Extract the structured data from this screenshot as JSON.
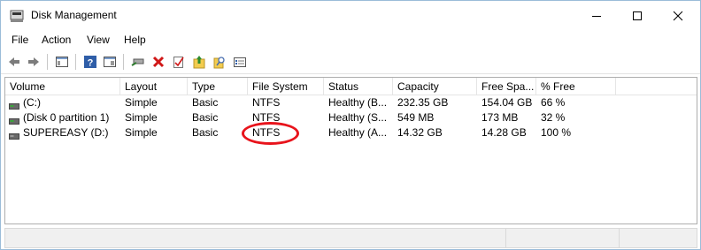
{
  "window": {
    "title": "Disk Management"
  },
  "menu": {
    "items": [
      "File",
      "Action",
      "View",
      "Help"
    ]
  },
  "toolbar": {
    "buttons": [
      "back-arrow-icon",
      "forward-arrow-icon",
      "console-tree-icon",
      "help-icon",
      "properties-icon",
      "connect-drive-icon",
      "delete-icon",
      "checklist-icon",
      "up-folder-icon",
      "search-folder-icon",
      "settings-panel-icon"
    ]
  },
  "table": {
    "columns": [
      "Volume",
      "Layout",
      "Type",
      "File System",
      "Status",
      "Capacity",
      "Free Spa...",
      "% Free"
    ],
    "rows": [
      {
        "volume": "(C:)",
        "layout": "Simple",
        "type": "Basic",
        "fs": "NTFS",
        "status": "Healthy (B...",
        "capacity": "232.35 GB",
        "free": "154.04 GB",
        "pct": "66 %"
      },
      {
        "volume": "(Disk 0 partition 1)",
        "layout": "Simple",
        "type": "Basic",
        "fs": "NTFS",
        "status": "Healthy (S...",
        "capacity": "549 MB",
        "free": "173 MB",
        "pct": "32 %"
      },
      {
        "volume": "SUPEREASY (D:)",
        "layout": "Simple",
        "type": "Basic",
        "fs": "NTFS",
        "status": "Healthy (A...",
        "capacity": "14.32 GB",
        "free": "14.28 GB",
        "pct": "100 %"
      }
    ]
  },
  "colors": {
    "annotation": "#e8141c",
    "window_border": "#9bbcd9"
  }
}
